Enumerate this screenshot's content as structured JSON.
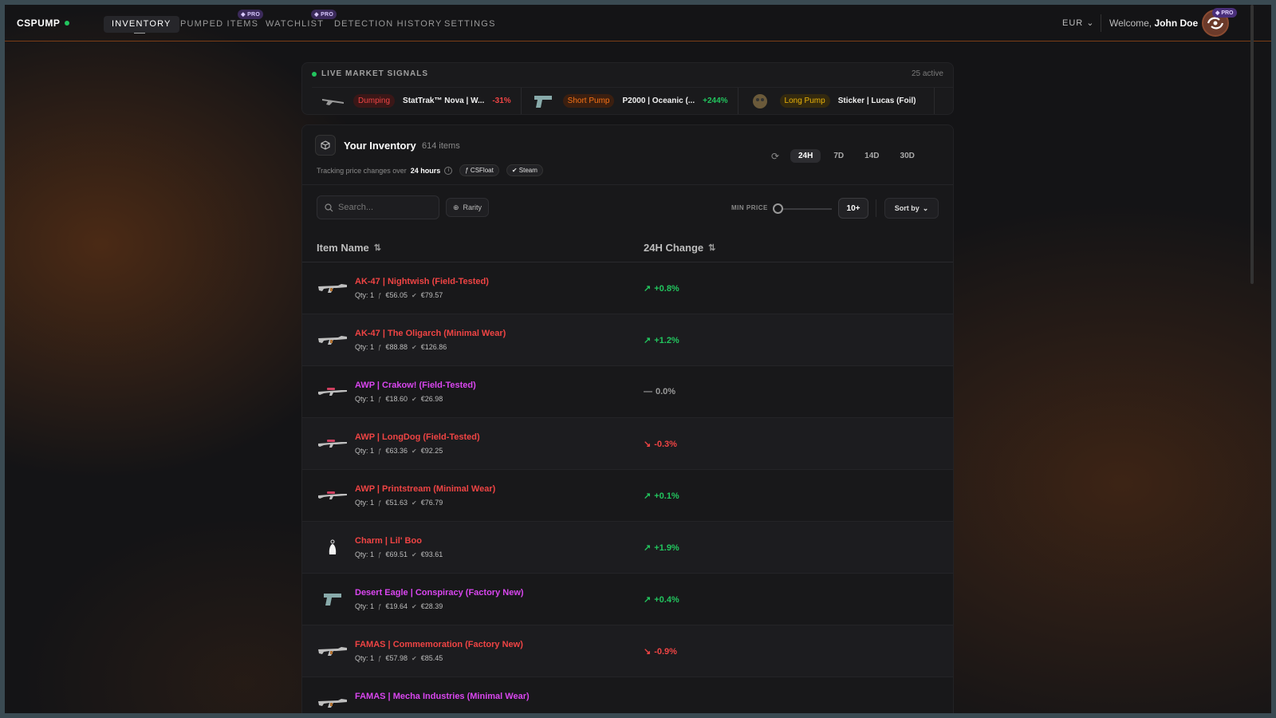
{
  "nav": {
    "brand": "CSPUMP",
    "items": [
      {
        "label": "INVENTORY",
        "active": true,
        "pro": false
      },
      {
        "label": "PUMPED ITEMS",
        "active": false,
        "pro": true
      },
      {
        "label": "WATCHLIST",
        "active": false,
        "pro": true
      },
      {
        "label": "DETECTION HISTORY",
        "active": false,
        "pro": false
      },
      {
        "label": "SETTINGS",
        "active": false,
        "pro": false
      }
    ],
    "pro_label": "PRO",
    "currency": "EUR",
    "welcome_prefix": "Welcome,",
    "user_name": "John Doe"
  },
  "signals": {
    "title": "LIVE MARKET SIGNALS",
    "count": "25 active",
    "items": [
      {
        "tag": "Dumping",
        "tag_color": "#ef4444",
        "tag_bg": "#3a1717",
        "name": "StatTrak™ Nova | W...",
        "change": "-31%",
        "change_color": "#ef4444",
        "icon": "shotgun-icon"
      },
      {
        "tag": "Short Pump",
        "tag_color": "#f97316",
        "tag_bg": "#3b1f10",
        "name": "P2000 | Oceanic (...",
        "change": "+244%",
        "change_color": "#22c55e",
        "icon": "pistol-icon"
      },
      {
        "tag": "Long Pump",
        "tag_color": "#eab308",
        "tag_bg": "#33290f",
        "name": "Sticker | Lucas (Foil)",
        "change": "",
        "change_color": "#22c55e",
        "icon": "sticker-icon"
      }
    ]
  },
  "inventory": {
    "title": "Your Inventory",
    "count": "614 items",
    "subtitle_prefix": "Tracking price changes over",
    "subtitle_period": "24 hours",
    "sources": [
      "CSFloat",
      "Steam"
    ],
    "ranges": [
      {
        "label": "24H",
        "active": true
      },
      {
        "label": "7D",
        "active": false
      },
      {
        "label": "14D",
        "active": false
      },
      {
        "label": "30D",
        "active": false
      }
    ],
    "search_placeholder": "Search...",
    "rarity_label": "Rarity",
    "min_price_label": "MIN PRICE",
    "min_price_value": "10+",
    "sort_label": "Sort by",
    "columns": {
      "name": "Item Name",
      "change": "24H Change"
    },
    "rows": [
      {
        "name": "AK-47 | Nightwish (Field-Tested)",
        "color": "#ef4444",
        "qty": "Qty: 1",
        "csfloat": "€56.05",
        "steam": "€79.57",
        "change": "+0.8%",
        "dir": "up",
        "icon": "rifle-icon"
      },
      {
        "name": "AK-47 | The Oligarch (Minimal Wear)",
        "color": "#ef4444",
        "qty": "Qty: 1",
        "csfloat": "€88.88",
        "steam": "€126.86",
        "change": "+1.2%",
        "dir": "up",
        "icon": "rifle-icon"
      },
      {
        "name": "AWP | Crakow! (Field-Tested)",
        "color": "#d946ef",
        "qty": "Qty: 1",
        "csfloat": "€18.60",
        "steam": "€26.98",
        "change": "0.0%",
        "dir": "flat",
        "icon": "sniper-icon"
      },
      {
        "name": "AWP | LongDog (Field-Tested)",
        "color": "#ef4444",
        "qty": "Qty: 1",
        "csfloat": "€63.36",
        "steam": "€92.25",
        "change": "-0.3%",
        "dir": "down",
        "icon": "sniper-icon"
      },
      {
        "name": "AWP | Printstream (Minimal Wear)",
        "color": "#ef4444",
        "qty": "Qty: 1",
        "csfloat": "€51.63",
        "steam": "€76.79",
        "change": "+0.1%",
        "dir": "up",
        "icon": "sniper-icon"
      },
      {
        "name": "Charm | Lil' Boo",
        "color": "#ef4444",
        "qty": "Qty: 1",
        "csfloat": "€69.51",
        "steam": "€93.61",
        "change": "+1.9%",
        "dir": "up",
        "icon": "charm-icon"
      },
      {
        "name": "Desert Eagle | Conspiracy (Factory New)",
        "color": "#d946ef",
        "qty": "Qty: 1",
        "csfloat": "€19.64",
        "steam": "€28.39",
        "change": "+0.4%",
        "dir": "up",
        "icon": "pistol-icon"
      },
      {
        "name": "FAMAS | Commemoration (Factory New)",
        "color": "#ef4444",
        "qty": "Qty: 1",
        "csfloat": "€57.98",
        "steam": "€85.45",
        "change": "-0.9%",
        "dir": "down",
        "icon": "rifle-icon"
      },
      {
        "name": "FAMAS | Mecha Industries (Minimal Wear)",
        "color": "#d946ef",
        "qty": "",
        "csfloat": "",
        "steam": "",
        "change": "",
        "dir": "none",
        "icon": "rifle-icon"
      }
    ]
  }
}
